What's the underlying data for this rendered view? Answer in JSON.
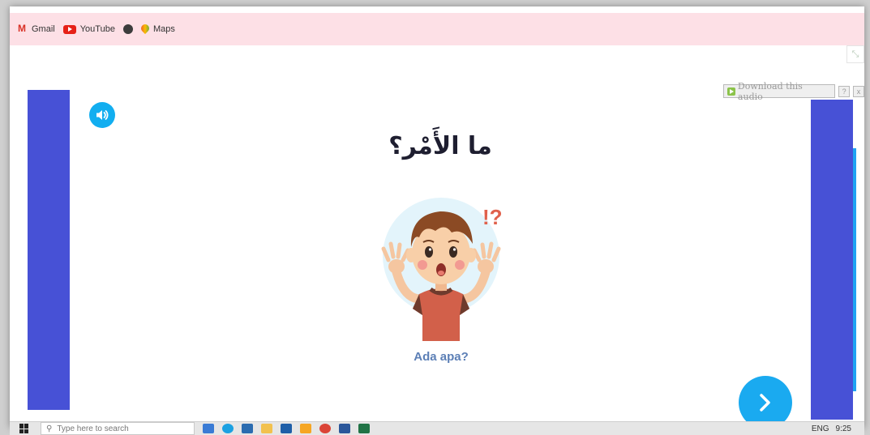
{
  "bookmarks": [
    {
      "label": "Gmail",
      "icon": "gmail-icon"
    },
    {
      "label": "YouTube",
      "icon": "youtube-icon"
    },
    {
      "label": "",
      "icon": "globe-icon"
    },
    {
      "label": "Maps",
      "icon": "maps-icon"
    }
  ],
  "audio_bar": {
    "download_label": "Download this audio",
    "help": "?",
    "close": "x"
  },
  "lesson": {
    "arabic_text": "ما الأَمْر؟",
    "caption": "Ada apa?",
    "exclamation": "!?"
  },
  "taskbar": {
    "search_placeholder": "Type here to search",
    "clock": "9:25",
    "lang": "ENG"
  },
  "colors": {
    "panel": "#4751d6",
    "accent_button": "#1aaaf0",
    "bookmarks_bar": "#fde0e6",
    "caption": "#5c7fb6"
  }
}
